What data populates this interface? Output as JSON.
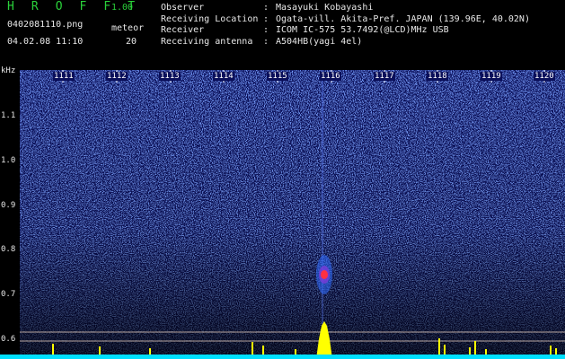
{
  "header": {
    "app_title": "H R O F F T",
    "app_version": "1.00",
    "filename": "0402081110.png",
    "meteor_label": "meteor",
    "datetime": "04.02.08 11:10",
    "meteor_count": "20"
  },
  "info": [
    {
      "key": "Observer",
      "value": "Masayuki Kobayashi"
    },
    {
      "key": "Receiving Location",
      "value": "Ogata-vill. Akita-Pref. JAPAN (139.96E, 40.02N)"
    },
    {
      "key": "Receiver",
      "value": "ICOM IC-575 53.7492(@LCD)MHz USB"
    },
    {
      "key": "Receiving antenna",
      "value": "A504HB(yagi 4el)"
    }
  ],
  "spectrogram": {
    "y_unit": "kHz",
    "y_ticks": [
      "1.1",
      "1.0",
      "0.9",
      "0.8",
      "0.7",
      "0.6"
    ],
    "time_ticks": [
      "1111",
      "1112",
      "1113",
      "1114",
      "1115",
      "1116",
      "1117",
      "1118",
      "1119",
      "1120"
    ],
    "colors": {
      "background": "#0a0f5a",
      "noise": "#2a4ad8",
      "signal": "#ff3040",
      "trace": "#ffff00",
      "baseline": "#00e0ff"
    }
  }
}
